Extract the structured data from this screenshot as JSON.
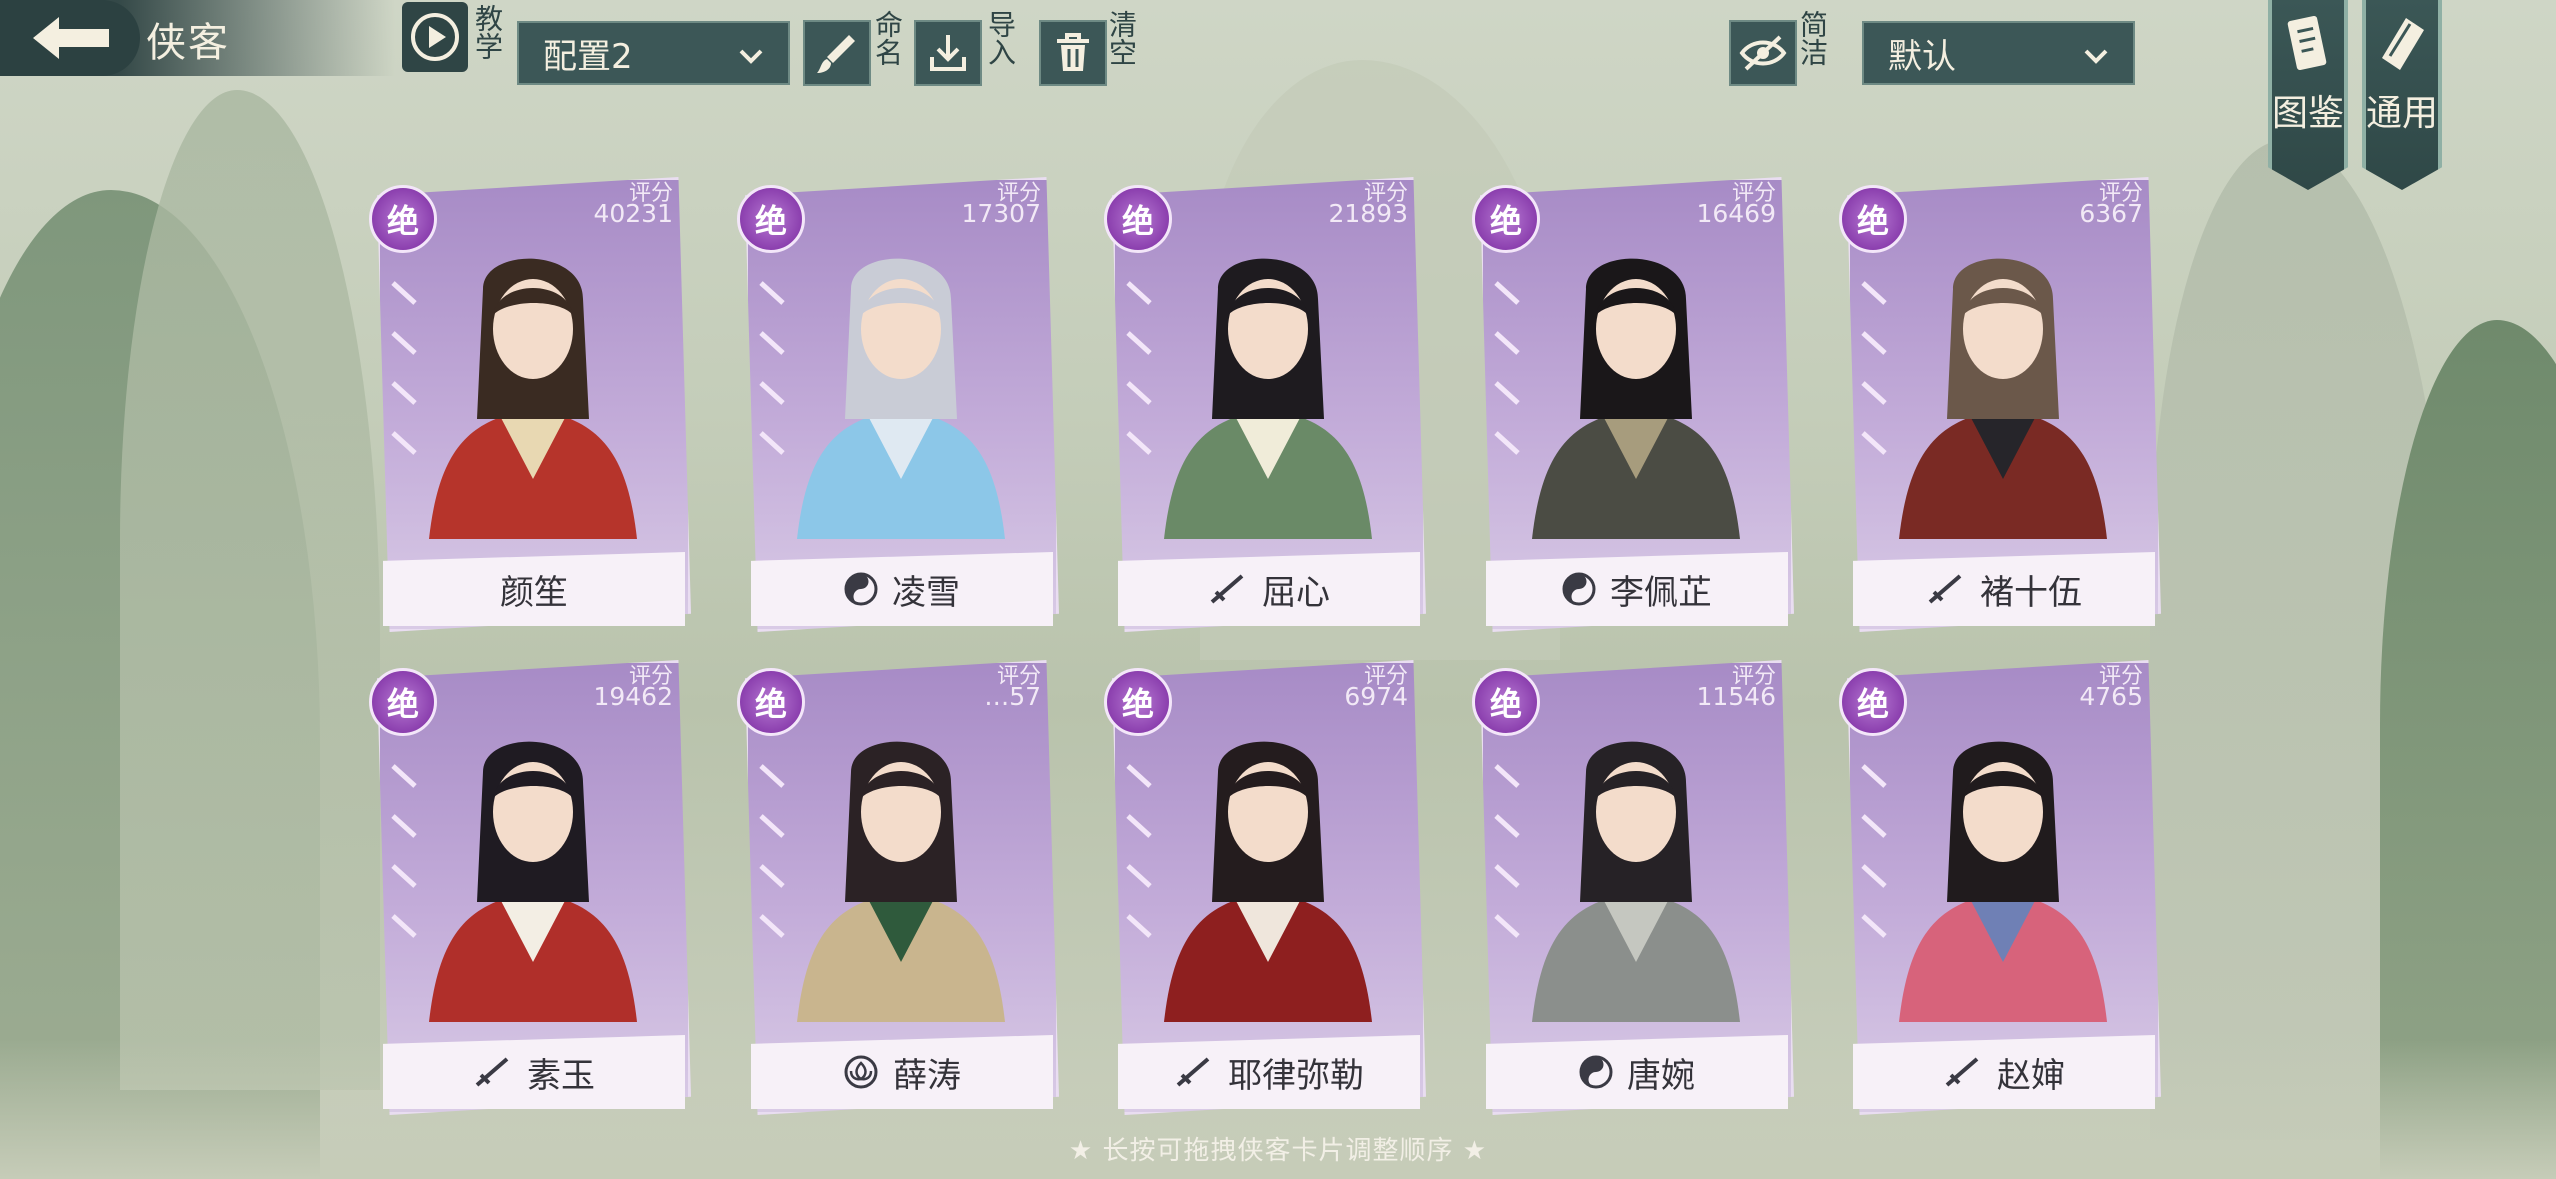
{
  "header": {
    "title": "侠客",
    "tutorial_label": "教学",
    "config_select": "配置2",
    "rename_label": "命名",
    "import_label": "导入",
    "clear_label": "清空",
    "simple_label": "简洁",
    "sort_select": "默认",
    "codex_label": "图鉴",
    "general_label": "通用"
  },
  "score_label": "评分",
  "rank_label": "绝",
  "cards": [
    {
      "name": "颜笙",
      "score": "40231",
      "type_icon": "none-icon"
    },
    {
      "name": "凌雪",
      "score": "17307",
      "type_icon": "yin-yang-icon"
    },
    {
      "name": "屈心",
      "score": "21893",
      "type_icon": "sword-icon"
    },
    {
      "name": "李佩芷",
      "score": "16469",
      "type_icon": "yin-yang-icon"
    },
    {
      "name": "褚十伍",
      "score": "6367",
      "type_icon": "sword-icon"
    },
    {
      "name": "素玉",
      "score": "19462",
      "type_icon": "sword-icon"
    },
    {
      "name": "薛涛",
      "score": "…57",
      "type_icon": "lotus-icon"
    },
    {
      "name": "耶律弥勒",
      "score": "6974",
      "type_icon": "sword-icon"
    },
    {
      "name": "唐婉",
      "score": "11546",
      "type_icon": "yin-yang-icon"
    },
    {
      "name": "赵婶",
      "score": "4765",
      "type_icon": "sword-icon"
    }
  ],
  "footer_hint": "★ 长按可拖拽侠客卡片调整顺序 ★",
  "colors": {
    "panel": "#3c5757",
    "card_purple": "#a78bc6",
    "badge": "#8b3fae",
    "text_light": "#f4efe0"
  }
}
